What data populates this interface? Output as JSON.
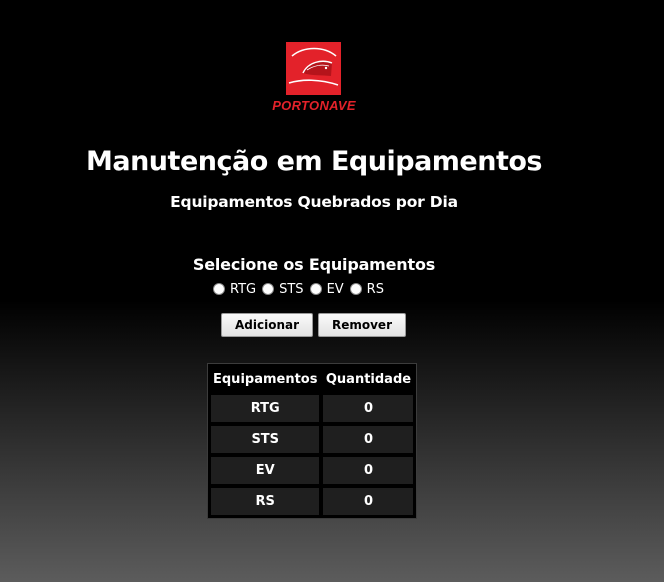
{
  "logo": {
    "text": "PORTONAVE",
    "brand_color": "#e3222a"
  },
  "page": {
    "title": "Manutenção em Equipamentos",
    "subtitle": "Equipamentos Quebrados por Dia"
  },
  "selection": {
    "label": "Selecione os Equipamentos",
    "options": [
      "RTG",
      "STS",
      "EV",
      "RS"
    ]
  },
  "buttons": {
    "add_label": "Adicionar",
    "remove_label": "Remover"
  },
  "table": {
    "headers": [
      "Equipamentos",
      "Quantidade"
    ],
    "rows": [
      {
        "equipment": "RTG",
        "quantity": "0"
      },
      {
        "equipment": "STS",
        "quantity": "0"
      },
      {
        "equipment": "EV",
        "quantity": "0"
      },
      {
        "equipment": "RS",
        "quantity": "0"
      }
    ]
  }
}
